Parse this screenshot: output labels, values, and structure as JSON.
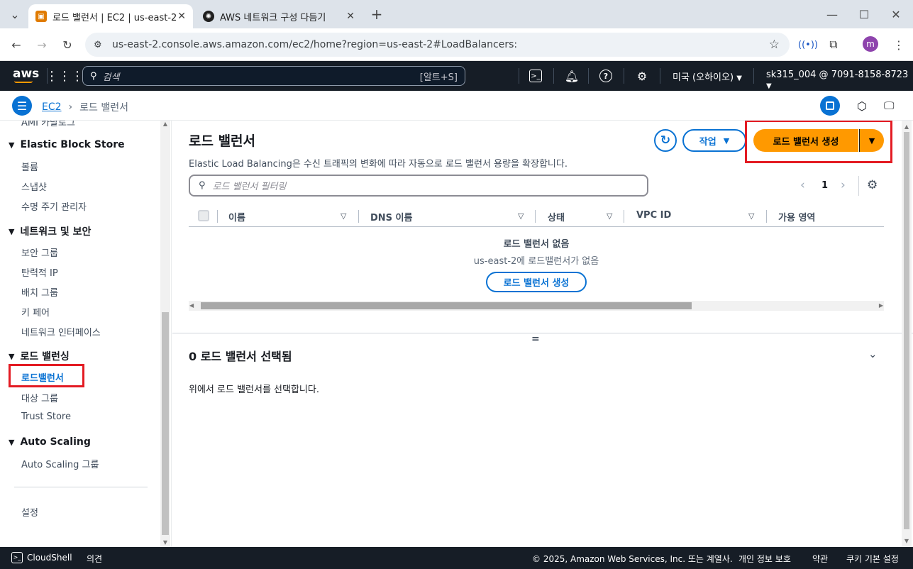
{
  "browser": {
    "tabs": [
      {
        "title": "로드 밸런서 | EC2 | us-east-2",
        "close": "✕"
      },
      {
        "title": "AWS 네트워크 구성 다듬기",
        "close": "✕"
      }
    ],
    "new_tab": "+",
    "url": "us-east-2.console.aws.amazon.com/ec2/home?region=us-east-2#LoadBalancers:",
    "profile_initial": "m",
    "window_controls": [
      "minimize",
      "maximize",
      "close"
    ]
  },
  "aws_nav": {
    "logo": "aws",
    "search_placeholder": "검색",
    "search_shortcut": "[알트+S]",
    "region": "미국 (오하이오)",
    "account": "sk315_004 @ 7091-8158-8723"
  },
  "breadcrumb": {
    "service": "EC2",
    "current": "로드 밸런서"
  },
  "sidebar": {
    "cut_item": "AMI 카탈로그",
    "sections": [
      {
        "title": "Elastic Block Store",
        "items": [
          "볼륨",
          "스냅샷",
          "수명 주기 관리자"
        ]
      },
      {
        "title": "네트워크 및 보안",
        "items": [
          "보안 그룹",
          "탄력적 IP",
          "배치 그룹",
          "키 페어",
          "네트워크 인터페이스"
        ]
      },
      {
        "title": "로드 밸런싱",
        "items": [
          "로드밸런서",
          "대상 그룹",
          "Trust Store"
        ]
      },
      {
        "title": "Auto Scaling",
        "items": [
          "Auto Scaling 그룹"
        ]
      }
    ],
    "settings": "설정"
  },
  "main": {
    "title": "로드 밸런서",
    "description": "Elastic Load Balancing은 수신 트래픽의 변화에 따라 자동으로 로드 밸런서 용량을 확장합니다.",
    "actions_label": "작업",
    "create_label": "로드 밸런서 생성",
    "filter_placeholder": "로드 밸런서 필터링",
    "page": "1",
    "columns": [
      "이름",
      "DNS 이름",
      "상태",
      "VPC ID",
      "가용 영역"
    ],
    "empty_title": "로드 밸런서 없음",
    "empty_desc": "us-east-2에 로드밸런서가 없음",
    "empty_button": "로드 밸런서 생성",
    "split_handle": "=",
    "selected_title": "0 로드 밸런서 선택됨",
    "selected_desc": "위에서 로드 밸런서를 선택합니다."
  },
  "footer": {
    "cloudshell": "CloudShell",
    "feedback": "의견",
    "copyright": "© 2025, Amazon Web Services, Inc. 또는 계열사.",
    "privacy": "개인 정보 보호",
    "terms": "약관",
    "cookies": "쿠키 기본 설정"
  },
  "colors": {
    "aws_nav_bg": "#161d26",
    "primary_orange": "#ff9900",
    "link_blue": "#0972d3",
    "highlight_red": "#e31b23"
  }
}
